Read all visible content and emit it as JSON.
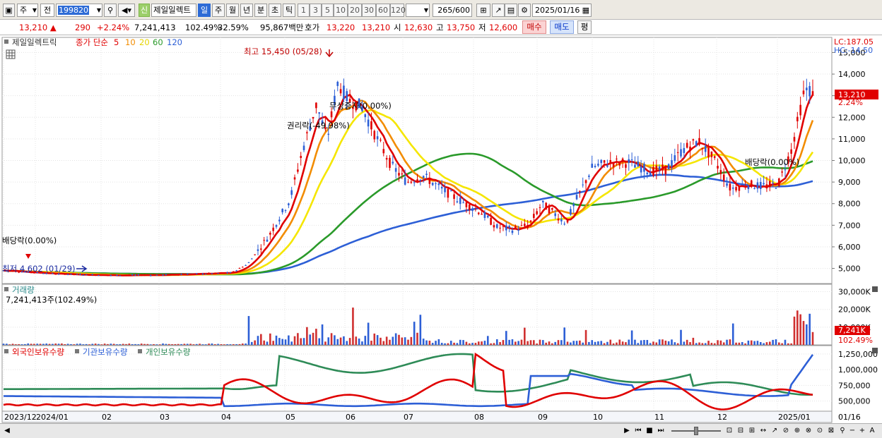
{
  "toolbar": {
    "period_select": "주",
    "prev_label": "전",
    "stock_code": "199820",
    "stock_name": "제일일렉트",
    "new_badge": "신",
    "periods": [
      "일",
      "주",
      "월",
      "년",
      "분",
      "초",
      "틱"
    ],
    "active_period": "일",
    "intervals": [
      "1",
      "3",
      "5",
      "10",
      "20",
      "30",
      "60",
      "120"
    ],
    "count": "265",
    "count_max": "/600",
    "date": "2025/01/16"
  },
  "quote": {
    "price": "13,210",
    "direction": "▲",
    "change": "290",
    "change_pct": "+2.24%",
    "volume": "7,241,413",
    "volume_ratio": "102.49%",
    "turnover": "32.59%",
    "amount": "95,867백만",
    "ask_label": "호가",
    "ask": "13,220",
    "bid": "13,210",
    "open_label": "시",
    "open": "12,630",
    "high_label": "고",
    "high": "13,750",
    "low_label": "저",
    "low": "12,600",
    "buy_label": "매수",
    "sell_label": "매도",
    "eval_label": "평"
  },
  "price_panel": {
    "stock_label": "제일일렉트릭",
    "ma_prefix": "종가 단순",
    "ma_periods": [
      "5",
      "10",
      "20",
      "60",
      "120"
    ],
    "ma_colors": [
      "#e00000",
      "#f28c00",
      "#f5e600",
      "#2a9a2a",
      "#2d5fd6"
    ],
    "lc": "LC:187.05",
    "hc": "HC:-14.50",
    "current_price_tag": "13,210",
    "current_pct_tag": "2.24%",
    "annotations": {
      "high": "최고 15,450 (05/28)",
      "low": "최저 4,602 (01/29)",
      "dividend1": "배당락(0.00%)",
      "dividend2": "배당락(0.00%)",
      "free_issue": "무상증자(0.00%)",
      "rights": "권리락(-49.98%)"
    },
    "y_ticks": [
      "15,000",
      "14,000",
      "13,000",
      "12,000",
      "11,000",
      "10,000",
      "9,000",
      "8,000",
      "7,000",
      "6,000",
      "5,000"
    ]
  },
  "volume_panel": {
    "title": "거래량",
    "value_label": "7,241,413주(102.49%)",
    "y_ticks": [
      "30,000K",
      "20,000K",
      "10,000K"
    ],
    "current_tag": "7,241K",
    "current_pct_tag": "102.49%"
  },
  "holdings_panel": {
    "series": [
      {
        "name": "외국인보유수량",
        "color": "#e00000"
      },
      {
        "name": "기관보유수량",
        "color": "#2d5fd6"
      },
      {
        "name": "개인보유수량",
        "color": "#2e8b57"
      }
    ],
    "y_ticks": [
      "1,250,000",
      "1,000,000",
      "750,000",
      "500,000"
    ]
  },
  "x_axis": {
    "labels": [
      "2023/12",
      "2024/01",
      "02",
      "03",
      "04",
      "05",
      "06",
      "07",
      "08",
      "09",
      "10",
      "11",
      "12",
      "2025/01"
    ],
    "right_label": "01/16"
  },
  "chart_data": {
    "type": "candlestick",
    "price_min": 4602,
    "price_max": 15450,
    "price_axis_range": [
      4300,
      15700
    ],
    "last_close": 13210,
    "volume_axis_max_k": 33000,
    "holdings_axis_range": [
      350000,
      1350000
    ]
  }
}
